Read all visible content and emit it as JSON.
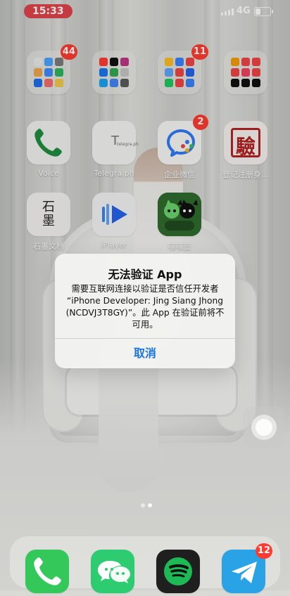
{
  "status_bar": {
    "time": "15:33",
    "network": "4G",
    "battery_level": 0.35
  },
  "home": {
    "folders": [
      {
        "badge": "44"
      },
      {
        "badge": ""
      },
      {
        "badge": "11"
      },
      {
        "badge": ""
      }
    ],
    "apps": [
      {
        "id": "voice",
        "label": "Voice",
        "badge": ""
      },
      {
        "id": "telegraph",
        "label": "Telegra.ph",
        "badge": "",
        "icon_text_big": "T",
        "icon_text_small": "telegra.ph"
      },
      {
        "id": "wecom",
        "label": "企业微信",
        "badge": "2"
      },
      {
        "id": "seal",
        "label": "登记注册身…",
        "badge": "",
        "icon_text": "驗"
      },
      {
        "id": "shimo",
        "label": "石墨文档",
        "badge": "",
        "icon_text": "石\n墨"
      },
      {
        "id": "iplayer",
        "label": "iPlayer",
        "badge": ""
      },
      {
        "id": "meow",
        "label": "喵喵签",
        "badge": ""
      }
    ]
  },
  "alert": {
    "title": "无法验证 App",
    "message_lines": [
      "需要互联网连接以验证是否信任开发者",
      "“iPhone Developer: Jing Siang Jhong",
      "(NCDVJ3T8GY)”。此 App 在验证前将不",
      "可用。"
    ],
    "button": "取消"
  },
  "dock": {
    "apps": [
      {
        "id": "phone",
        "badge": ""
      },
      {
        "id": "wechat",
        "badge": ""
      },
      {
        "id": "spotify",
        "badge": ""
      },
      {
        "id": "telegram",
        "badge": "12"
      }
    ]
  },
  "icons": {
    "voice": "phone-icon",
    "phone": "phone-icon",
    "wecom": "chat-icon",
    "wechat": "wechat-icon",
    "spotify": "spotify-icon",
    "telegram": "paper-plane-icon",
    "iplayer": "play-icon",
    "assistive": "assistive-touch-icon"
  }
}
